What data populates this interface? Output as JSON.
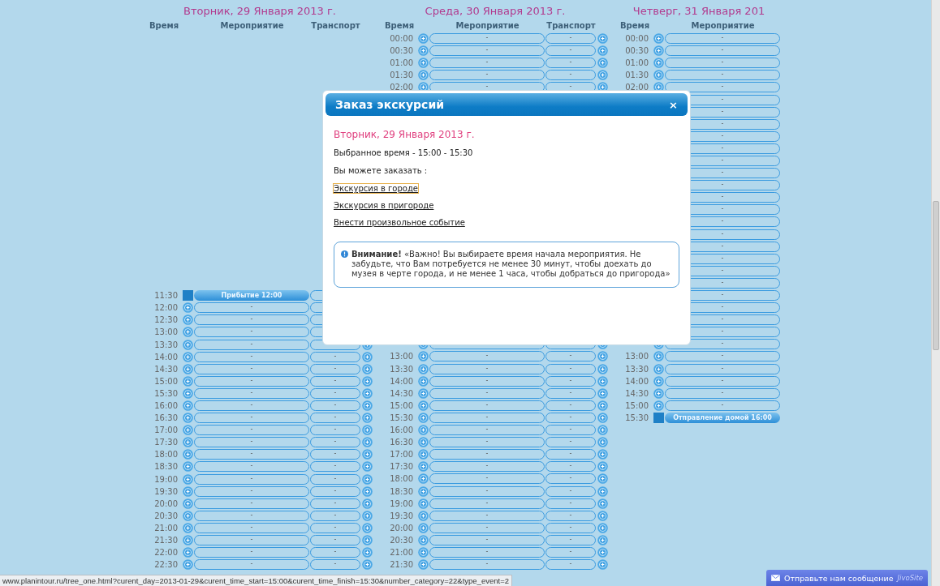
{
  "days": [
    {
      "title": "Вторник, 29 Января 2013 г.",
      "columns": [
        "Время",
        "Мероприятие",
        "Транспорт"
      ],
      "rows": [
        {
          "kind": "fixed",
          "time": "11:30",
          "event": "Прибытие 12:00"
        },
        {
          "kind": "slot",
          "time": "12:00",
          "event": "-"
        },
        {
          "kind": "slot",
          "time": "12:30",
          "event": "-"
        },
        {
          "kind": "slot",
          "time": "13:00",
          "event": "-"
        },
        {
          "kind": "slot",
          "time": "13:30",
          "event": "-"
        },
        {
          "kind": "slot",
          "time": "14:00",
          "event": "-",
          "transport": "-"
        },
        {
          "kind": "slot",
          "time": "14:30",
          "event": "-",
          "transport": "-"
        },
        {
          "kind": "slot",
          "time": "15:00",
          "event": "-",
          "transport": "-"
        },
        {
          "kind": "slot",
          "time": "15:30",
          "event": "-",
          "transport": "-"
        },
        {
          "kind": "slot",
          "time": "16:00",
          "event": "-",
          "transport": "-"
        },
        {
          "kind": "slot",
          "time": "16:30",
          "event": "-",
          "transport": "-"
        },
        {
          "kind": "slot",
          "time": "17:00",
          "event": "-",
          "transport": "-"
        },
        {
          "kind": "slot",
          "time": "17:30",
          "event": "-",
          "transport": "-"
        },
        {
          "kind": "slot",
          "time": "18:00",
          "event": "-",
          "transport": "-"
        },
        {
          "kind": "slot",
          "time": "18:30",
          "event": "-",
          "transport": "-"
        },
        {
          "kind": "slot",
          "time": "19:00",
          "event": "-",
          "transport": "-"
        },
        {
          "kind": "slot",
          "time": "19:30",
          "event": "-",
          "transport": "-"
        },
        {
          "kind": "slot",
          "time": "20:00",
          "event": "-",
          "transport": "-"
        },
        {
          "kind": "slot",
          "time": "20:30",
          "event": "-",
          "transport": "-"
        },
        {
          "kind": "slot",
          "time": "21:00",
          "event": "-",
          "transport": "-"
        },
        {
          "kind": "slot",
          "time": "21:30",
          "event": "-",
          "transport": "-"
        },
        {
          "kind": "slot",
          "time": "22:00",
          "event": "-",
          "transport": "-"
        },
        {
          "kind": "slot",
          "time": "22:30",
          "event": "-",
          "transport": "-"
        }
      ]
    },
    {
      "title": "Среда, 30 Января 2013 г.",
      "columns": [
        "Время",
        "Мероприятие",
        "Транспорт"
      ],
      "rows": [
        {
          "kind": "slot",
          "time": "00:00",
          "event": "-",
          "transport": "-"
        },
        {
          "kind": "slot",
          "time": "00:30",
          "event": "-",
          "transport": "-"
        },
        {
          "kind": "slot",
          "time": "01:00",
          "event": "-",
          "transport": "-"
        },
        {
          "kind": "slot",
          "time": "01:30",
          "event": "-",
          "transport": "-"
        },
        {
          "kind": "slot",
          "time": "02:00",
          "event": "-",
          "transport": "-"
        },
        {
          "kind": "slot"
        },
        {
          "kind": "slot"
        },
        {
          "kind": "slot"
        },
        {
          "kind": "slot"
        },
        {
          "kind": "slot"
        },
        {
          "kind": "slot"
        },
        {
          "kind": "slot"
        },
        {
          "kind": "slot"
        },
        {
          "kind": "slot"
        },
        {
          "kind": "slot"
        },
        {
          "kind": "slot"
        },
        {
          "kind": "slot"
        },
        {
          "kind": "slot"
        },
        {
          "kind": "slot"
        },
        {
          "kind": "slot"
        },
        {
          "kind": "slot"
        },
        {
          "kind": "slot"
        },
        {
          "kind": "slot"
        },
        {
          "kind": "slot"
        },
        {
          "kind": "slot"
        },
        {
          "kind": "slot"
        },
        {
          "kind": "slot",
          "time": "13:00",
          "event": "-",
          "transport": "-"
        },
        {
          "kind": "slot",
          "time": "13:30",
          "event": "-",
          "transport": "-"
        },
        {
          "kind": "slot",
          "time": "14:00",
          "event": "-",
          "transport": "-"
        },
        {
          "kind": "slot",
          "time": "14:30",
          "event": "-",
          "transport": "-"
        },
        {
          "kind": "slot",
          "time": "15:00",
          "event": "-",
          "transport": "-"
        },
        {
          "kind": "slot",
          "time": "15:30",
          "event": "-",
          "transport": "-"
        },
        {
          "kind": "slot",
          "time": "16:00",
          "event": "-",
          "transport": "-"
        },
        {
          "kind": "slot",
          "time": "16:30",
          "event": "-",
          "transport": "-"
        },
        {
          "kind": "slot",
          "time": "17:00",
          "event": "-",
          "transport": "-"
        },
        {
          "kind": "slot",
          "time": "17:30",
          "event": "-",
          "transport": "-"
        },
        {
          "kind": "slot",
          "time": "18:00",
          "event": "-",
          "transport": "-"
        },
        {
          "kind": "slot",
          "time": "18:30",
          "event": "-",
          "transport": "-"
        },
        {
          "kind": "slot",
          "time": "19:00",
          "event": "-",
          "transport": "-"
        },
        {
          "kind": "slot",
          "time": "19:30",
          "event": "-",
          "transport": "-"
        },
        {
          "kind": "slot",
          "time": "20:00",
          "event": "-",
          "transport": "-"
        },
        {
          "kind": "slot",
          "time": "20:30",
          "event": "-",
          "transport": "-"
        },
        {
          "kind": "slot",
          "time": "21:00",
          "event": "-",
          "transport": "-"
        },
        {
          "kind": "slot",
          "time": "21:30",
          "event": "-",
          "transport": "-"
        }
      ]
    },
    {
      "title": "Четверг, 31 Января 201",
      "columns": [
        "Время",
        "Мероприятие"
      ],
      "rows": [
        {
          "kind": "slot",
          "time": "00:00",
          "event": "-"
        },
        {
          "kind": "slot",
          "time": "00:30",
          "event": "-"
        },
        {
          "kind": "slot",
          "time": "01:00",
          "event": "-"
        },
        {
          "kind": "slot",
          "time": "01:30",
          "event": "-"
        },
        {
          "kind": "slot",
          "time": "02:00",
          "event": "-"
        },
        {
          "kind": "slot",
          "event": "-"
        },
        {
          "kind": "slot",
          "event": "-"
        },
        {
          "kind": "slot",
          "event": "-"
        },
        {
          "kind": "slot",
          "event": "-"
        },
        {
          "kind": "slot",
          "event": "-"
        },
        {
          "kind": "slot",
          "event": "-"
        },
        {
          "kind": "slot",
          "event": "-"
        },
        {
          "kind": "slot",
          "event": "-"
        },
        {
          "kind": "slot",
          "event": "-"
        },
        {
          "kind": "slot",
          "event": "-"
        },
        {
          "kind": "slot",
          "event": "-"
        },
        {
          "kind": "slot",
          "event": "-"
        },
        {
          "kind": "slot",
          "event": "-"
        },
        {
          "kind": "slot",
          "event": "-"
        },
        {
          "kind": "slot",
          "event": "-"
        },
        {
          "kind": "slot",
          "event": "-"
        },
        {
          "kind": "slot",
          "event": "-"
        },
        {
          "kind": "slot",
          "event": "-"
        },
        {
          "kind": "slot",
          "event": "-"
        },
        {
          "kind": "slot",
          "event": "-"
        },
        {
          "kind": "slot",
          "event": "-"
        },
        {
          "kind": "slot",
          "time": "13:00",
          "event": "-"
        },
        {
          "kind": "slot",
          "time": "13:30",
          "event": "-"
        },
        {
          "kind": "slot",
          "time": "14:00",
          "event": "-"
        },
        {
          "kind": "slot",
          "time": "14:30",
          "event": "-"
        },
        {
          "kind": "slot",
          "time": "15:00",
          "event": "-"
        },
        {
          "kind": "fixed",
          "time": "15:30",
          "event": "Отправление домой 16:00"
        }
      ]
    }
  ],
  "modal": {
    "title": "Заказ экскурсий",
    "close": "×",
    "date": "Вторник, 29 Января 2013 г.",
    "selected_time": "Выбранное время - 15:00 - 15:30",
    "prompt": "Вы можете заказать :",
    "links": [
      {
        "label": "Экскурсия в городе",
        "focused": true
      },
      {
        "label": "Экскурсия в пригороде",
        "focused": false
      },
      {
        "label": "Внести произвольное событие",
        "focused": false
      }
    ],
    "notice": "**Внимание!** «Важно! Вы выбираете время начала мероприятия. Не забудьте, что Вам потребуется не менее 30 минут, чтобы доехать до музея в черте города, и не менее 1 часа, чтобы добраться до пригорода»"
  },
  "status_bar": {
    "url": "www.planintour.ru/tree_one.html?curent_day=2013-01-29&curent_time_start=15:00&curent_time_finish=15:30&number_category=22&type_event=2"
  },
  "chat_widget": {
    "label": "Отправьте нам сообщение",
    "brand": "JivoSite"
  }
}
